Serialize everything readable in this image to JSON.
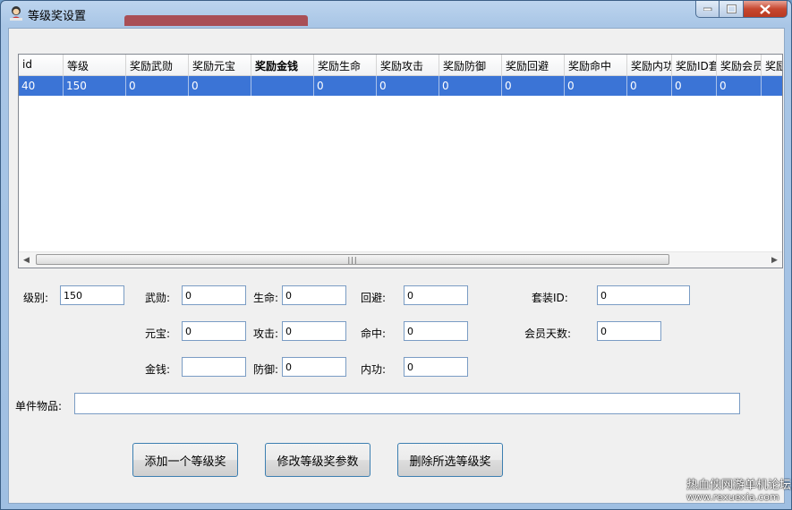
{
  "window": {
    "title": "等级奖设置"
  },
  "table": {
    "columns": [
      "id",
      "等级",
      "奖励武勋",
      "奖励元宝",
      "奖励金钱",
      "奖励生命",
      "奖励攻击",
      "奖励防御",
      "奖励回避",
      "奖励命中",
      "奖励内功",
      "奖励ID套",
      "奖励会员",
      "奖励"
    ],
    "rows": [
      [
        "40",
        "150",
        "0",
        "0",
        "",
        "0",
        "0",
        "0",
        "0",
        "0",
        "0",
        "0",
        "0",
        ""
      ]
    ]
  },
  "form": {
    "level_label": "级别:",
    "level_value": "150",
    "wuxun_label": "武勋:",
    "wuxun_value": "0",
    "yuanbao_label": "元宝:",
    "yuanbao_value": "0",
    "jinqian_label": "金钱:",
    "jinqian_value": "",
    "shengming_label": "生命:",
    "shengming_value": "0",
    "gongji_label": "攻击:",
    "gongji_value": "0",
    "fangyu_label": "防御:",
    "fangyu_value": "0",
    "huibi_label": "回避:",
    "huibi_value": "0",
    "mingzhong_label": "命中:",
    "mingzhong_value": "0",
    "neigong_label": "内功:",
    "neigong_value": "0",
    "taozhuang_label": "套装ID:",
    "taozhuang_value": "0",
    "huiyuan_label": "会员天数:",
    "huiyuan_value": "0",
    "item_label": "单件物品:",
    "item_value": ""
  },
  "buttons": {
    "add": "添加一个等级奖",
    "modify": "修改等级奖参数",
    "delete": "删除所选等级奖"
  },
  "watermark": {
    "line1": "热血侠网游单机论坛",
    "line2": "www.rexuexia.com"
  }
}
